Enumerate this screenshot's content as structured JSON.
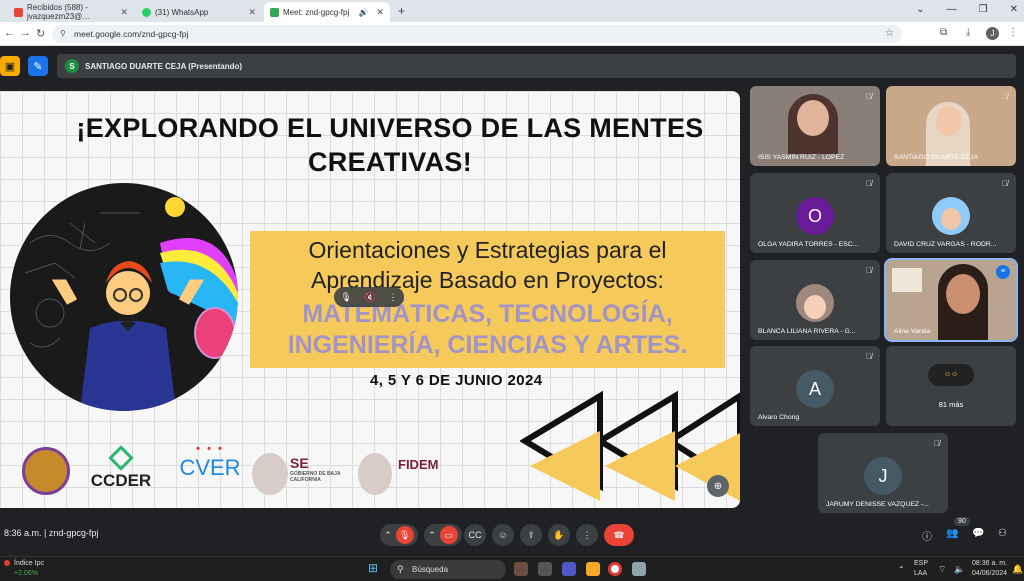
{
  "browser": {
    "tabs": [
      {
        "label": "Recibidos (588) - jvazquezm23@…",
        "icon_color": "#ea4335",
        "x": 0
      },
      {
        "label": "(31) WhatsApp",
        "icon_color": "#25d366",
        "x": 1
      },
      {
        "label": "Meet: znd-gpcg-fpj",
        "icon_color": "#34a853",
        "x": 2
      }
    ],
    "url": "meet.google.com/znd-gpcg-fpj",
    "new_tab": "+",
    "profile_initial": "J"
  },
  "meet": {
    "presenter_label": "SANTIAGO DUARTE CEJA (Presentando)",
    "presenter_initial": "S",
    "meeting_code": "znd-gpcg-fpj",
    "time": "8:36 a.m.",
    "participant_count": "90",
    "more_count": "81 más"
  },
  "slide": {
    "title": "¡EXPLORANDO EL UNIVERSO DE LAS MENTES CREATIVAS!",
    "subtitle": "Orientaciones y Estrategias para el Aprendizaje Basado en Proyectos:",
    "highlight": "MATEMÁTICAS, TECNOLOGÍA, INGENIERÍA, CIENCIAS Y ARTES.",
    "dates": "4, 5 Y 6 DE JUNIO 2024",
    "logos": {
      "ccder": "CCDER",
      "cver": "CVER",
      "se": "SE",
      "se_sub": "GOBIERNO DE BAJA CALIFORNIA",
      "fidem": "FIDEM"
    }
  },
  "participants": [
    {
      "name": "ISIS YASMIN RUIZ - LOPEZ",
      "type": "video"
    },
    {
      "name": "SANTIAGO DUARTE CEJA",
      "type": "video"
    },
    {
      "name": "OLGA YADIRA TORRES - ESC...",
      "type": "avatar",
      "initial": "O",
      "color": "#6a1b9a"
    },
    {
      "name": "DAVID CRUZ VARGAS - RODR...",
      "type": "photo"
    },
    {
      "name": "BLANCA LILIANA RIVERA - G...",
      "type": "photo"
    },
    {
      "name": "Aline Varela",
      "type": "video"
    },
    {
      "name": "Alvaro Chong",
      "type": "avatar",
      "initial": "A",
      "color": "#455a64"
    },
    {
      "name": "81 más",
      "type": "more"
    },
    {
      "name": "JARUMY DENISSE VAZQUEZ -...",
      "type": "avatar",
      "initial": "J",
      "color": "#455a64"
    }
  ],
  "taskbar": {
    "stock_name": "Índice Ipc",
    "stock_change": "+2.06%",
    "search_placeholder": "Búsqueda",
    "lang_top": "ESP",
    "lang_bottom": "LAA",
    "clock_time": "08:36 a. m.",
    "clock_date": "04/06/2024"
  }
}
